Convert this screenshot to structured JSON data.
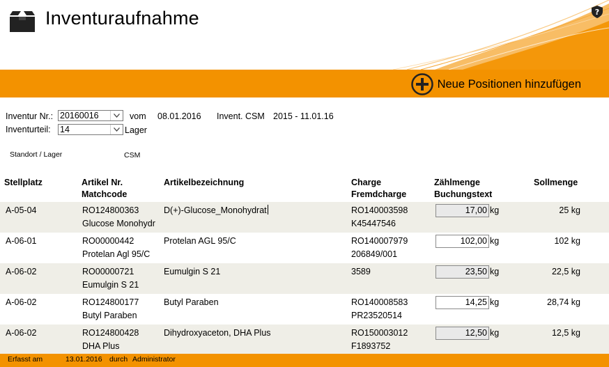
{
  "header": {
    "title": "Inventuraufnahme",
    "icon": "box-icon",
    "help_icon": "shield-question-icon"
  },
  "toolbar": {
    "add_label": "Neue Positionen hinzufügen",
    "add_icon": "plus-circle-icon"
  },
  "form": {
    "inventur_nr_label": "Inventur Nr.:",
    "inventur_nr_value": "20160016",
    "vom_label": "vom",
    "vom_value": "08.01.2016",
    "invent_label": "Invent. CSM",
    "invent_range": "2015 - 11.01.16",
    "inventurteil_label": "Inventurteil:",
    "inventurteil_value": "14",
    "lager_label": "Lager",
    "standort_label": "Standort / Lager",
    "standort_value": "CSM"
  },
  "table": {
    "headers": {
      "stellplatz": "Stellplatz",
      "artikel_nr": "Artikel Nr.",
      "matchcode": "Matchcode",
      "bezeichnung": "Artikelbezeichnung",
      "charge": "Charge",
      "fremdcharge": "Fremdcharge",
      "zaehlmenge": "Zählmenge",
      "buchungstext": "Buchungstext",
      "sollmenge": "Sollmenge"
    },
    "rows": [
      {
        "stellplatz": "A-05-04",
        "artikel_nr": "RO124800363",
        "matchcode": "Glucose Monohydr",
        "bezeichnung": "D(+)-Glucose_Monohydrat",
        "charge": "RO140003598",
        "fremdcharge": "K45447546",
        "zaehlmenge": "17,00",
        "unit": "kg",
        "sollmenge": "25 kg"
      },
      {
        "stellplatz": "A-06-01",
        "artikel_nr": "RO00000442",
        "matchcode": "Protelan Agl 95/C",
        "bezeichnung": "Protelan AGL 95/C",
        "charge": "RO140007979",
        "fremdcharge": "206849/001",
        "zaehlmenge": "102,00",
        "unit": "kg",
        "sollmenge": "102 kg"
      },
      {
        "stellplatz": "A-06-02",
        "artikel_nr": "RO00000721",
        "matchcode": "Eumulgin S 21",
        "bezeichnung": "Eumulgin S 21",
        "charge": "3589",
        "fremdcharge": "",
        "zaehlmenge": "23,50",
        "unit": "kg",
        "sollmenge": "22,5 kg"
      },
      {
        "stellplatz": "A-06-02",
        "artikel_nr": "RO124800177",
        "matchcode": "Butyl Paraben",
        "bezeichnung": "Butyl Paraben",
        "charge": "RO140008583",
        "fremdcharge": "PR23520514",
        "zaehlmenge": "14,25",
        "unit": "kg",
        "sollmenge": "28,74 kg"
      },
      {
        "stellplatz": "A-06-02",
        "artikel_nr": "RO124800428",
        "matchcode": "DHA Plus",
        "bezeichnung": "Dihydroxyaceton, DHA Plus",
        "charge": "RO150003012",
        "fremdcharge": "F1893752",
        "zaehlmenge": "12,50",
        "unit": "kg",
        "sollmenge": "12,5 kg"
      }
    ]
  },
  "footer": {
    "erfasst_label": "Erfasst am",
    "erfasst_date": "13.01.2016",
    "durch_label": "durch",
    "user": "Administrator"
  },
  "colors": {
    "accent": "#f39200",
    "row_shade": "#efeee7"
  }
}
